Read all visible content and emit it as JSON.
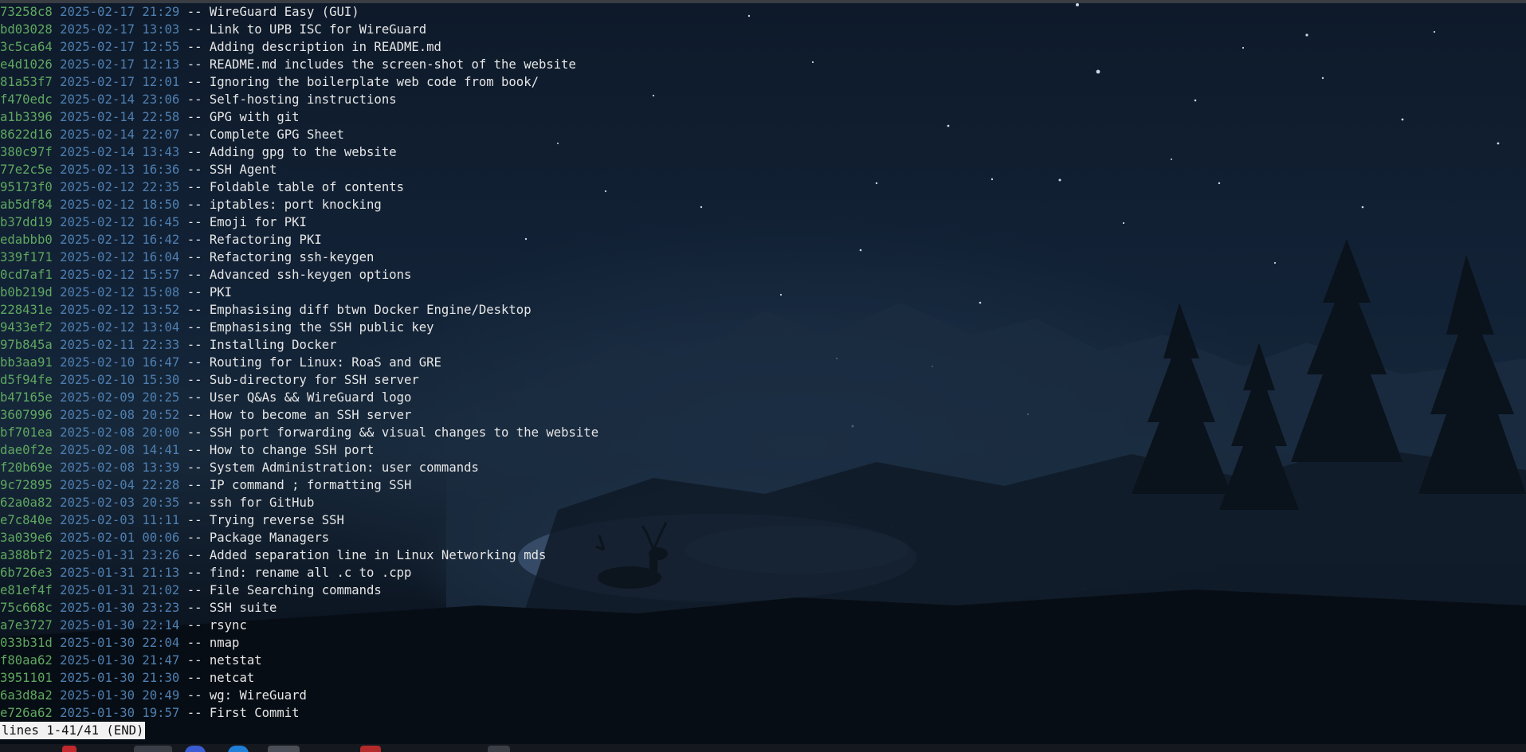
{
  "terminal": {
    "status_line": "lines 1-41/41 (END)",
    "separator": "--",
    "colors": {
      "hash": "#5fa860",
      "date": "#4f7fb0",
      "text": "#e6e6e6"
    },
    "commits": [
      {
        "hash": "73258c8",
        "date": "2025-02-17 21:29",
        "message": "WireGuard Easy (GUI)"
      },
      {
        "hash": "bd03028",
        "date": "2025-02-17 13:03",
        "message": "Link to UPB ISC for WireGuard"
      },
      {
        "hash": "3c5ca64",
        "date": "2025-02-17 12:55",
        "message": "Adding description in README.md"
      },
      {
        "hash": "e4d1026",
        "date": "2025-02-17 12:13",
        "message": "README.md includes the screen-shot of the website"
      },
      {
        "hash": "81a53f7",
        "date": "2025-02-17 12:01",
        "message": "Ignoring the boilerplate web code from book/"
      },
      {
        "hash": "f470edc",
        "date": "2025-02-14 23:06",
        "message": "Self-hosting instructions"
      },
      {
        "hash": "a1b3396",
        "date": "2025-02-14 22:58",
        "message": "GPG with git"
      },
      {
        "hash": "8622d16",
        "date": "2025-02-14 22:07",
        "message": "Complete GPG Sheet"
      },
      {
        "hash": "380c97f",
        "date": "2025-02-14 13:43",
        "message": "Adding gpg to the website"
      },
      {
        "hash": "77e2c5e",
        "date": "2025-02-13 16:36",
        "message": "SSH Agent"
      },
      {
        "hash": "95173f0",
        "date": "2025-02-12 22:35",
        "message": "Foldable table of contents"
      },
      {
        "hash": "ab5df84",
        "date": "2025-02-12 18:50",
        "message": "iptables: port knocking"
      },
      {
        "hash": "b37dd19",
        "date": "2025-02-12 16:45",
        "message": "Emoji for PKI"
      },
      {
        "hash": "edabbb0",
        "date": "2025-02-12 16:42",
        "message": "Refactoring PKI"
      },
      {
        "hash": "339f171",
        "date": "2025-02-12 16:04",
        "message": "Refactoring ssh-keygen"
      },
      {
        "hash": "0cd7af1",
        "date": "2025-02-12 15:57",
        "message": "Advanced ssh-keygen options"
      },
      {
        "hash": "b0b219d",
        "date": "2025-02-12 15:08",
        "message": "PKI"
      },
      {
        "hash": "228431e",
        "date": "2025-02-12 13:52",
        "message": "Emphasising diff btwn Docker Engine/Desktop"
      },
      {
        "hash": "9433ef2",
        "date": "2025-02-12 13:04",
        "message": "Emphasising the SSH public key"
      },
      {
        "hash": "97b845a",
        "date": "2025-02-11 22:33",
        "message": "Installing Docker"
      },
      {
        "hash": "bb3aa91",
        "date": "2025-02-10 16:47",
        "message": "Routing for Linux: RoaS and GRE"
      },
      {
        "hash": "d5f94fe",
        "date": "2025-02-10 15:30",
        "message": "Sub-directory for SSH server"
      },
      {
        "hash": "b47165e",
        "date": "2025-02-09 20:25",
        "message": "User Q&As && WireGuard logo"
      },
      {
        "hash": "3607996",
        "date": "2025-02-08 20:52",
        "message": "How to become an SSH server"
      },
      {
        "hash": "bf701ea",
        "date": "2025-02-08 20:00",
        "message": "SSH port forwarding && visual changes to the website"
      },
      {
        "hash": "dae0f2e",
        "date": "2025-02-08 14:41",
        "message": "How to change SSH port"
      },
      {
        "hash": "f20b69e",
        "date": "2025-02-08 13:39",
        "message": "System Administration: user commands"
      },
      {
        "hash": "9c72895",
        "date": "2025-02-04 22:28",
        "message": "IP command ; formatting SSH"
      },
      {
        "hash": "62a0a82",
        "date": "2025-02-03 20:35",
        "message": "ssh for GitHub"
      },
      {
        "hash": "e7c840e",
        "date": "2025-02-03 11:11",
        "message": "Trying reverse SSH"
      },
      {
        "hash": "3a039e6",
        "date": "2025-02-01 00:06",
        "message": "Package Managers"
      },
      {
        "hash": "a388bf2",
        "date": "2025-01-31 23:26",
        "message": "Added separation line in Linux Networking mds"
      },
      {
        "hash": "6b726e3",
        "date": "2025-01-31 21:13",
        "message": "find: rename all .c to .cpp"
      },
      {
        "hash": "e81ef4f",
        "date": "2025-01-31 21:02",
        "message": "File Searching commands"
      },
      {
        "hash": "75c668c",
        "date": "2025-01-30 23:23",
        "message": "SSH suite"
      },
      {
        "hash": "a7e3727",
        "date": "2025-01-30 22:14",
        "message": "rsync"
      },
      {
        "hash": "033b31d",
        "date": "2025-01-30 22:04",
        "message": "nmap"
      },
      {
        "hash": "f80aa62",
        "date": "2025-01-30 21:47",
        "message": "netstat"
      },
      {
        "hash": "3951101",
        "date": "2025-01-30 21:30",
        "message": "netcat"
      },
      {
        "hash": "6a3d8a2",
        "date": "2025-01-30 20:49",
        "message": "wg: WireGuard"
      },
      {
        "hash": "e726a62",
        "date": "2025-01-30 19:57",
        "message": "First Commit"
      }
    ]
  },
  "wallpaper": {
    "description_icon": "night-forest-deer-wallpaper"
  }
}
